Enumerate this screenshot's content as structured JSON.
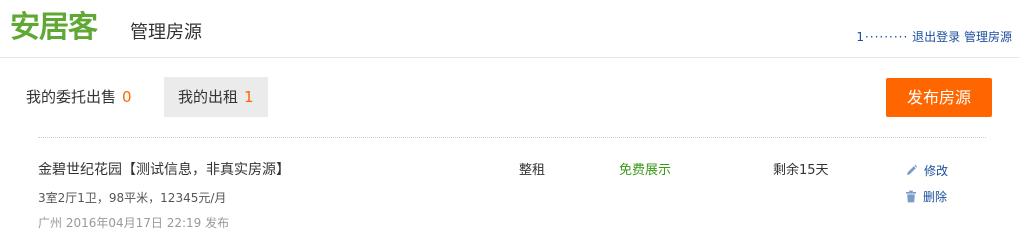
{
  "header": {
    "logo": "安居客",
    "title": "管理房源",
    "username_masked": "1·········",
    "logout": "退出登录",
    "manage_link": "管理房源"
  },
  "tabs": [
    {
      "label": "我的委托出售",
      "count": "0"
    },
    {
      "label": "我的出租",
      "count": "1"
    }
  ],
  "publish_button": "发布房源",
  "listing": {
    "title": "金碧世纪花园【测试信息，非真实房源】",
    "spec": "3室2厅1卫，98平米，12345元/月",
    "date": "广州 2016年04月17日 22:19 发布",
    "rent_type": "整租",
    "status": "免费展示",
    "remaining": "剩余15天",
    "edit_label": "修改",
    "delete_label": "删除"
  },
  "colors": {
    "brand_green": "#5fa833",
    "accent_orange": "#ff6600",
    "link_blue": "#1a4e9c",
    "status_green": "#3a9a19"
  },
  "icons": {
    "edit": "pencil-icon",
    "delete": "trash-icon"
  }
}
